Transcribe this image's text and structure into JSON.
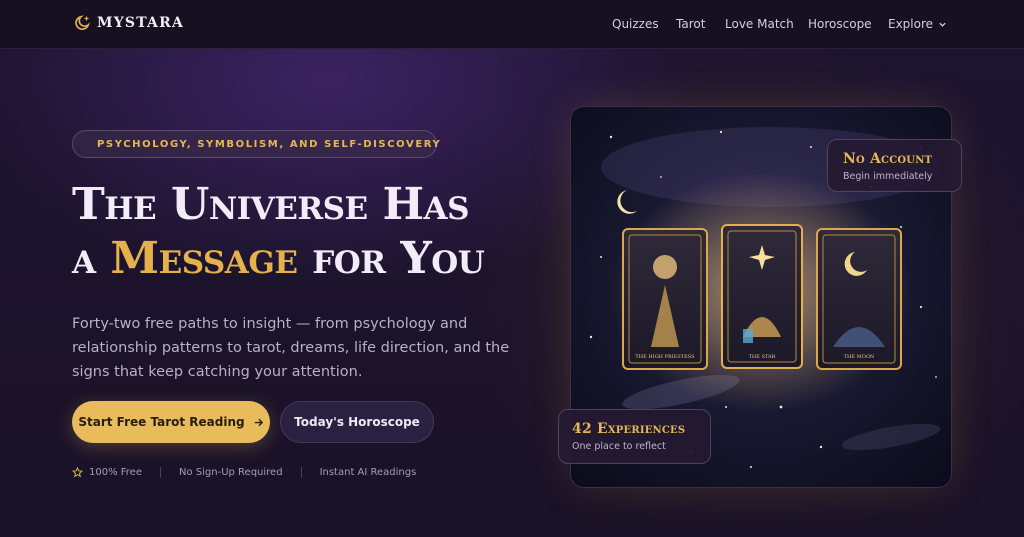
{
  "brand": {
    "name": "MYSTARA"
  },
  "nav": {
    "links": [
      "Quizzes",
      "Tarot",
      "Love Match",
      "Horoscope",
      "Explore"
    ]
  },
  "hero": {
    "badge": "PSYCHOLOGY, SYMBOLISM, AND SELF-DISCOVERY",
    "headline": {
      "line1": "The Universe Has",
      "line2_pre": "a ",
      "line2_gold": "Message",
      "line2_post": " for You"
    },
    "subtitle": "Forty-two free paths to insight — from psychology and relationship patterns to tarot, dreams, life direction, and the signs that keep catching your attention.",
    "primary_cta": "Start Free Tarot Reading",
    "secondary_cta": "Today's Horoscope",
    "features": [
      "100% Free",
      "No Sign-Up Required",
      "Instant AI Readings"
    ]
  },
  "art": {
    "cards": [
      "THE HIGH PRIESTESS",
      "THE STAR",
      "THE MOON"
    ],
    "float_top": {
      "title": "No Account",
      "subtitle": "Begin immediately"
    },
    "float_bottom": {
      "title": "42 Experiences",
      "subtitle": "One place to reflect"
    }
  },
  "colors": {
    "accent": "#e4b14c",
    "background": "#1a1226",
    "button": "#e8bc5a"
  },
  "icons": {
    "logo": "crescent-moon-sparkle-icon",
    "badge": "crescent-moon-icon",
    "explore": "chevron-down-icon",
    "cta": "arrow-right-icon",
    "feature": "star-outline-icon"
  }
}
